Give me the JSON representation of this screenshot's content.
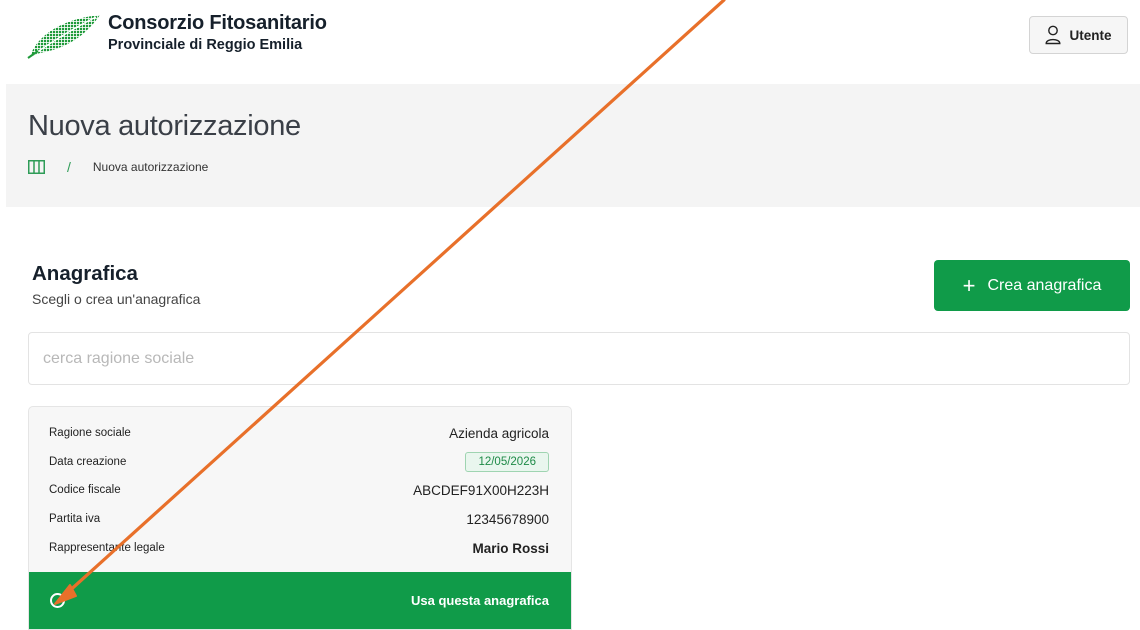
{
  "brand": {
    "title": "Consorzio Fitosanitario",
    "subtitle": "Provinciale di Reggio Emilia"
  },
  "user_button": {
    "label": "Utente",
    "icon": "user-icon"
  },
  "page": {
    "title": "Nuova autorizzazione",
    "breadcrumb": {
      "home_icon": "columns-icon",
      "separator": "/",
      "current": "Nuova autorizzazione"
    }
  },
  "section": {
    "title": "Anagrafica",
    "subtitle": "Scegli o crea un'anagrafica",
    "create_button": {
      "icon": "+",
      "label": "Crea anagrafica"
    }
  },
  "search": {
    "placeholder": "cerca ragione sociale",
    "value": ""
  },
  "card": {
    "fields": [
      {
        "label": "Ragione sociale",
        "value": "Azienda agricola"
      },
      {
        "label": "Data creazione",
        "value": "12/05/2026"
      },
      {
        "label": "Codice fiscale",
        "value": "ABCDEF91X00H223H"
      },
      {
        "label": "Partita iva",
        "value": "12345678900"
      },
      {
        "label": "Rappresentante legale",
        "value": "Mario Rossi"
      }
    ],
    "action_label": "Usa questa anagrafica",
    "selected": false
  },
  "colors": {
    "primary_green": "#109b49",
    "band_background": "#f4f4f4",
    "annotation_arrow": "#e8702a"
  }
}
